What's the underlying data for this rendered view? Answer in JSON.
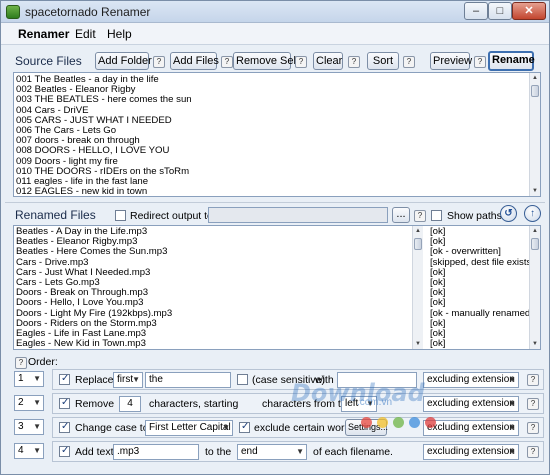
{
  "window": {
    "title": "spacetornado Renamer",
    "minimize": "–",
    "maximize": "□",
    "close": "✕"
  },
  "menu": [
    "Renamer",
    "Edit",
    "Help"
  ],
  "source": {
    "label": "Source Files",
    "buttons": [
      "Add Folder",
      "Add Files",
      "Remove Sel.",
      "Clear",
      "Sort",
      "Preview",
      "Rename"
    ],
    "help": "?",
    "files": [
      "001 The Beatles - a day in the life",
      "002 Beatles - Eleanor Rigby",
      "003 THE BEATLES - here comes the sun",
      "004 Cars - DriVE",
      "005 CARS - JUST WHAT I NEEDED",
      "006 The Cars - Lets Go",
      "007 doors - break on through",
      "008 DOORS - HELLO, I LOVE YOU",
      "009 Doors - light my fire",
      "010 THE DOORS - rIDErs on the sToRm",
      "011 eagles - life in the fast lane",
      "012 EAGLES - new kid in town"
    ]
  },
  "renamed": {
    "label": "Renamed Files",
    "redirect_label": "Redirect output to:",
    "redirect_value": "",
    "browse": "...",
    "show_paths": "Show paths",
    "files": [
      "Beatles - A Day in the Life.mp3",
      "Beatles - Eleanor Rigby.mp3",
      "Beatles - Here Comes the Sun.mp3",
      "Cars - Drive.mp3",
      "Cars - Just What I Needed.mp3",
      "Cars - Lets Go.mp3",
      "Doors - Break on Through.mp3",
      "Doors - Hello, I Love You.mp3",
      "Doors - Light My Fire (192kbps).mp3",
      "Doors - Riders on the Storm.mp3",
      "Eagles - Life in Fast Lane.mp3",
      "Eagles - New Kid in Town.mp3"
    ],
    "status": [
      "[ok]",
      "[ok]",
      "[ok - overwritten]",
      "[skipped, dest file exists]",
      "[ok]",
      "[ok]",
      "[ok]",
      "[ok]",
      "[ok - manually renamed]",
      "[ok]",
      "[ok]",
      "[ok]"
    ]
  },
  "order": {
    "label": "Order:",
    "rows": [
      {
        "order": "1",
        "action": "Replace",
        "mode": "first",
        "value": "the",
        "case_label": "(case sensitive)",
        "with_label": "with",
        "with_value": "",
        "ext": "excluding extension"
      },
      {
        "order": "2",
        "action": "Remove",
        "count": "4",
        "text1": "characters, starting",
        "text2": "characters from the",
        "side": "left",
        "ext": "excluding extension"
      },
      {
        "order": "3",
        "action": "Change case to:",
        "case_value": "First Letter Capital",
        "exclude_label": "exclude certain words.",
        "settings": "Settings...",
        "ext": "excluding extension"
      },
      {
        "order": "4",
        "action": "Add text",
        "value": ".mp3",
        "to_label": "to the",
        "position": "end",
        "suffix": "of each filename.",
        "ext": "excluding extension"
      }
    ]
  },
  "watermark": {
    "text": "Download",
    "sub": ".com.vn"
  }
}
